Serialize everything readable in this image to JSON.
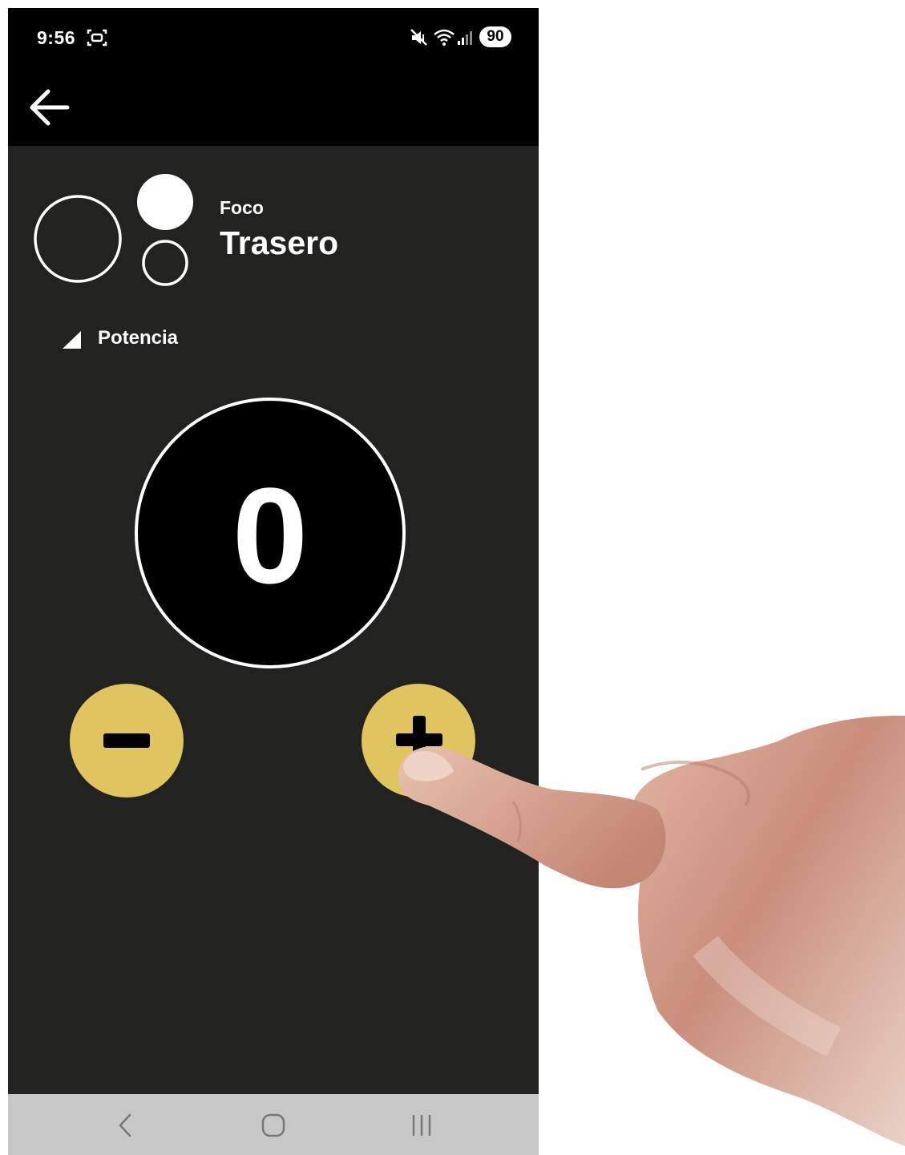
{
  "status_bar": {
    "time": "9:56",
    "battery": "90",
    "icons": [
      "screenshot-icon",
      "mute-icon",
      "wifi-icon",
      "signal-icon"
    ]
  },
  "app_bar": {
    "back_icon": "arrow-left-icon"
  },
  "device": {
    "label": "Foco",
    "name": "Trasero",
    "icon": "focus-circles-icon"
  },
  "power": {
    "label": "Potencia",
    "value": "0",
    "icon": "signal-triangle-icon"
  },
  "controls": {
    "decrease_icon": "minus-icon",
    "increase_icon": "plus-icon",
    "button_color": "#e0c45d"
  },
  "nav_bar": {
    "icons": [
      "nav-back-icon",
      "nav-home-icon",
      "nav-recents-icon"
    ]
  },
  "colors": {
    "background": "#222220",
    "bars": "#000000",
    "nav_bar": "#c8c8c8",
    "accent": "#e0c45d"
  }
}
